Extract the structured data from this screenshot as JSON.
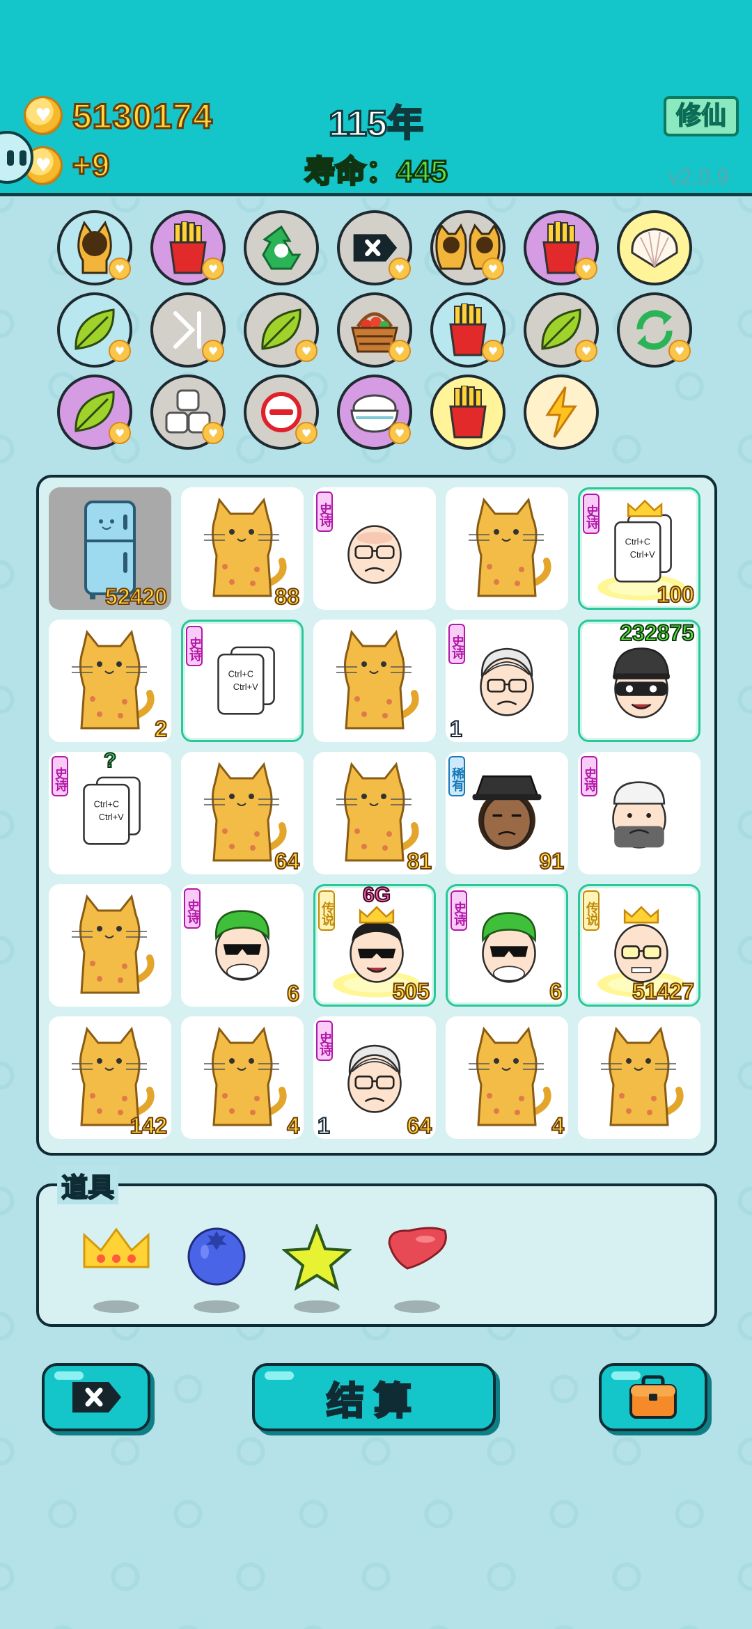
{
  "header": {
    "coins": "5130174",
    "coin_rate": "+9",
    "year": "115年",
    "lifespan": "寿命：445",
    "xiuxian_label": "修仙",
    "version": "v2.0.9"
  },
  "skills": [
    {
      "icon": "cat-face-icon",
      "bg": "#b9e7ef"
    },
    {
      "icon": "fries-icon",
      "bg": "#d59be3"
    },
    {
      "icon": "recycle-icon",
      "bg": "#d2d0c8"
    },
    {
      "icon": "close-tag-icon",
      "bg": "#d2d0c8"
    },
    {
      "icon": "cat-duo-icon",
      "bg": "#d2d0c8"
    },
    {
      "icon": "fries-icon",
      "bg": "#d59be3"
    },
    {
      "icon": "shell-icon",
      "bg": "#fff49a"
    },
    {
      "icon": "leaf-icon",
      "bg": "#b9e7ef"
    },
    {
      "icon": "skip-icon",
      "bg": "#d2d0c8"
    },
    {
      "icon": "leaf-icon",
      "bg": "#d2d0c8"
    },
    {
      "icon": "basket-icon",
      "bg": "#d2d0c8"
    },
    {
      "icon": "fries-icon",
      "bg": "#b9e7ef"
    },
    {
      "icon": "leaf-icon",
      "bg": "#d2d0c8"
    },
    {
      "icon": "refresh-icon",
      "bg": "#d2d0c8"
    },
    {
      "icon": "leaf-icon",
      "bg": "#d59be3"
    },
    {
      "icon": "cubes-icon",
      "bg": "#d2d0c8"
    },
    {
      "icon": "minus-circle-icon",
      "bg": "#d2d0c8"
    },
    {
      "icon": "rice-bowl-icon",
      "bg": "#d59be3"
    },
    {
      "icon": "fries-icon",
      "bg": "#fff49a"
    },
    {
      "icon": "lightning-icon",
      "bg": "#fff1c9"
    }
  ],
  "board": [
    [
      {
        "type": "fridge",
        "num": "52420",
        "grey": true
      },
      {
        "type": "cat",
        "num": "88"
      },
      {
        "type": "bald-glasses",
        "tag": "史诗",
        "tagType": "epic"
      },
      {
        "type": "cat"
      },
      {
        "type": "copy",
        "tag": "史诗",
        "tagType": "epic",
        "num": "100",
        "framed": true,
        "crown": true,
        "glow": true
      }
    ],
    [
      {
        "type": "cat",
        "num": "2"
      },
      {
        "type": "copy",
        "tag": "史诗",
        "tagType": "epic",
        "framed": true
      },
      {
        "type": "cat"
      },
      {
        "type": "old-man",
        "tag": "史诗",
        "tagType": "epic",
        "lnum": "1"
      },
      {
        "type": "thief",
        "topnum": "232875",
        "framed": true
      }
    ],
    [
      {
        "type": "copy",
        "tag": "史诗",
        "tagType": "epic",
        "topmark": "?"
      },
      {
        "type": "cat",
        "num": "64"
      },
      {
        "type": "cat",
        "num": "81"
      },
      {
        "type": "bucket-hat",
        "tag": "稀有",
        "tagType": "rare",
        "num": "91"
      },
      {
        "type": "cap-beard",
        "tag": "史诗",
        "tagType": "epic"
      }
    ],
    [
      {
        "type": "cat"
      },
      {
        "type": "green-hair",
        "tag": "史诗",
        "tagType": "epic",
        "num": "6"
      },
      {
        "type": "king-shades",
        "tag": "传说",
        "tagType": "legend",
        "num": "505",
        "framed": true,
        "topmark": "6G",
        "crown": true,
        "glow": true
      },
      {
        "type": "green-hair",
        "tag": "史诗",
        "tagType": "epic",
        "num": "6",
        "framed": true
      },
      {
        "type": "king-old",
        "tag": "传说",
        "tagType": "legend",
        "num": "51427",
        "framed": true,
        "crown": true,
        "glow": true
      }
    ],
    [
      {
        "type": "cat",
        "num": "142"
      },
      {
        "type": "cat",
        "num": "4"
      },
      {
        "type": "old-man",
        "tag": "史诗",
        "tagType": "epic",
        "num": "64",
        "lnum": "1"
      },
      {
        "type": "cat",
        "num": "4"
      },
      {
        "type": "cat"
      }
    ]
  ],
  "items_panel": {
    "title": "道具",
    "items": [
      {
        "icon": "crown-icon"
      },
      {
        "icon": "blueberry-icon"
      },
      {
        "icon": "star-icon"
      },
      {
        "icon": "liver-icon"
      }
    ]
  },
  "buttons": {
    "settle_label": "结算"
  }
}
